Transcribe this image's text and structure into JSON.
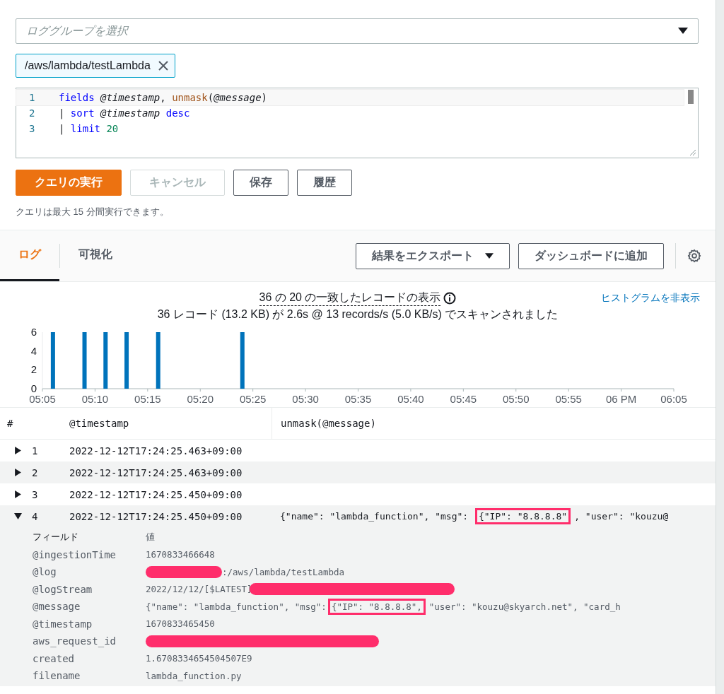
{
  "log_group_select": {
    "placeholder": "ロググループを選択"
  },
  "selected_groups": [
    {
      "label": "/aws/lambda/testLambda"
    }
  ],
  "editor": {
    "lines": [
      {
        "number": "1",
        "tokens": [
          {
            "kind": "keyword",
            "text": "fields"
          },
          {
            "kind": "field",
            "text": " @timestamp"
          },
          {
            "kind": "plain",
            "text": ", "
          },
          {
            "kind": "function",
            "text": "unmask"
          },
          {
            "kind": "plain",
            "text": "("
          },
          {
            "kind": "field",
            "text": "@message"
          },
          {
            "kind": "plain",
            "text": ")"
          }
        ]
      },
      {
        "number": "2",
        "tokens": [
          {
            "kind": "plain",
            "text": "| "
          },
          {
            "kind": "keyword",
            "text": "sort"
          },
          {
            "kind": "field",
            "text": " @timestamp"
          },
          {
            "kind": "keyword",
            "text": " desc"
          }
        ]
      },
      {
        "number": "3",
        "tokens": [
          {
            "kind": "plain",
            "text": "| "
          },
          {
            "kind": "keyword",
            "text": "limit"
          },
          {
            "kind": "number",
            "text": " 20"
          }
        ]
      }
    ]
  },
  "buttons": [
    {
      "label": "クエリの実行",
      "kind": "primary",
      "disabled": false
    },
    {
      "label": "キャンセル",
      "kind": "normal",
      "disabled": true
    },
    {
      "label": "保存",
      "kind": "normal",
      "disabled": false
    },
    {
      "label": "履歴",
      "kind": "normal",
      "disabled": false
    }
  ],
  "note": "クエリは最大 15 分間実行できます。",
  "tabs": [
    {
      "label": "ログ",
      "selected": true
    },
    {
      "label": "可視化",
      "selected": false
    }
  ],
  "actions": [
    {
      "label": "結果をエクスポート",
      "dropdown": true
    },
    {
      "label": "ダッシュボードに追加",
      "dropdown": false
    }
  ],
  "summary": {
    "matched": "36 の 20 の一致したレコードの表示",
    "scanned": "36 レコード (13.2 KB) が 2.6s @ 13 records/s (5.0 KB/s) でスキャンされました",
    "toggle": "ヒストグラムを非表示"
  },
  "chart_data": {
    "type": "bar",
    "ylim": [
      0,
      6
    ],
    "yticks": [
      0,
      2,
      4,
      6
    ],
    "categories": [
      "05:05",
      null,
      null,
      null,
      null,
      "05:10",
      null,
      null,
      null,
      null,
      "05:15",
      null,
      null,
      null,
      null,
      "05:20",
      null,
      null,
      null,
      null,
      "05:25",
      null,
      null,
      null,
      null,
      "05:30",
      null,
      null,
      null,
      null,
      "05:35",
      null,
      null,
      null,
      null,
      "05:40",
      null,
      null,
      null,
      null,
      "05:45",
      null,
      null,
      null,
      null,
      "05:50",
      null,
      null,
      null,
      null,
      "05:55",
      null,
      null,
      null,
      null,
      "06 PM",
      null,
      null,
      null,
      null,
      "06:05"
    ],
    "values": [
      null,
      6,
      null,
      null,
      6,
      null,
      6,
      null,
      6,
      null,
      null,
      6,
      null,
      null,
      null,
      null,
      null,
      null,
      null,
      6,
      null,
      null,
      null,
      null,
      null,
      null,
      null,
      null,
      null,
      null,
      null,
      null,
      null,
      null,
      null,
      null,
      null,
      null,
      null,
      null,
      null,
      null,
      null,
      null,
      null,
      null,
      null,
      null,
      null,
      null,
      null,
      null,
      null,
      null,
      null,
      null,
      null,
      null,
      null,
      null,
      null
    ]
  },
  "table": {
    "columns": [
      "#",
      "@timestamp",
      "unmask(@message)"
    ],
    "rows": [
      {
        "number": "1",
        "timestamp": "2022-12-12T17:24:25.463+09:00",
        "expanded": false
      },
      {
        "number": "2",
        "timestamp": "2022-12-12T17:24:25.463+09:00",
        "expanded": false
      },
      {
        "number": "3",
        "timestamp": "2022-12-12T17:24:25.450+09:00",
        "expanded": false
      },
      {
        "number": "4",
        "timestamp": "2022-12-12T17:24:25.450+09:00",
        "expanded": true,
        "message": {
          "before": "{\"name\": \"lambda_function\", \"msg\": ",
          "highlight": "{\"IP\": \"8.8.8.8\"",
          "after": ", \"user\": \"kouzu@"
        }
      }
    ]
  },
  "details": {
    "columns": [
      "フィールド",
      "値"
    ],
    "fields": [
      {
        "name": "@ingestionTime",
        "value": "1670833466648"
      },
      {
        "name": "@log",
        "parts": [
          {
            "kind": "redacted"
          },
          {
            "kind": "text",
            "text": ":/aws/lambda/testLambda"
          }
        ]
      },
      {
        "name": "@logStream",
        "parts": [
          {
            "kind": "text",
            "text": "2022/12/12/[$LATEST]"
          },
          {
            "kind": "redacted"
          }
        ]
      },
      {
        "name": "@message",
        "value": {
          "before": "{\"name\": \"lambda_function\", \"msg\": ",
          "highlight": "{\"IP\": \"8.8.8.8\",",
          "after": " \"user\": \"kouzu@skyarch.net\", \"card_h"
        }
      },
      {
        "name": "@timestamp",
        "value": "1670833465450"
      },
      {
        "name": "aws_request_id",
        "parts": [
          {
            "kind": "redacted"
          }
        ]
      },
      {
        "name": "created",
        "value": "1.6708334654504507E9"
      },
      {
        "name": "filename",
        "value": "lambda_function.py"
      }
    ]
  }
}
